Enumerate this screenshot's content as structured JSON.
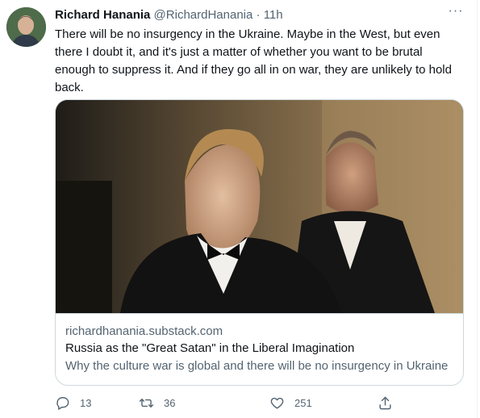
{
  "tweet": {
    "author_name": "Richard Hanania",
    "author_handle": "@RichardHanania",
    "separator": "·",
    "time": "11h",
    "text": "There will be no insurgency in the Ukraine. Maybe in the West, but even there I doubt it, and it's just a matter of whether you want to be brutal enough to suppress it. And if they go all in on war, they are unlikely to hold back.",
    "more_icon": "more-horizontal-icon"
  },
  "card": {
    "domain": "richardhanania.substack.com",
    "title": "Russia as the \"Great Satan\" in the Liberal Imagination",
    "description": "Why the culture war is global and there will be no insurgency in Ukraine"
  },
  "actions": {
    "reply_count": "13",
    "retweet_count": "36",
    "like_count": "251",
    "reply_icon": "reply-icon",
    "retweet_icon": "retweet-icon",
    "like_icon": "heart-icon",
    "share_icon": "share-icon"
  },
  "colors": {
    "text_primary": "#0f1419",
    "text_secondary": "#536471",
    "border": "#cfd9de"
  }
}
